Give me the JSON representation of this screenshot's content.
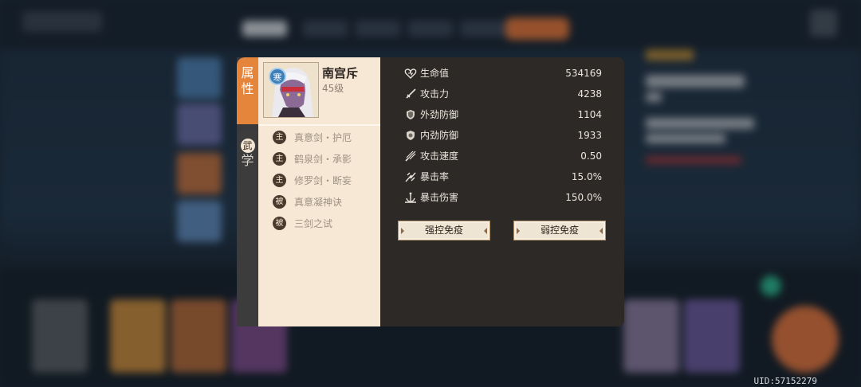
{
  "hero": {
    "name": "南宫斥",
    "level": "45级",
    "element_badge": "寒",
    "portrait": "hero-portrait-icon"
  },
  "side_tabs": [
    {
      "label_line1": "属",
      "label_line2": "性",
      "active": true
    },
    {
      "label_line1": "武",
      "label_line2": "学",
      "active": false
    }
  ],
  "skills": [
    {
      "tag": "主",
      "name": "真意剑・护厄"
    },
    {
      "tag": "主",
      "name": "鹤泉剑・承影"
    },
    {
      "tag": "主",
      "name": "修罗剑・断妄"
    },
    {
      "tag": "被",
      "name": "真意凝神诀"
    },
    {
      "tag": "被",
      "name": "三剑之试"
    }
  ],
  "stats": [
    {
      "icon": "heart-icon",
      "label": "生命值",
      "value": "534169"
    },
    {
      "icon": "sword-icon",
      "label": "攻击力",
      "value": "4238"
    },
    {
      "icon": "shield-icon",
      "label": "外劲防御",
      "value": "1104"
    },
    {
      "icon": "shield-icon",
      "label": "内劲防御",
      "value": "1933"
    },
    {
      "icon": "speed-icon",
      "label": "攻击速度",
      "value": "0.50"
    },
    {
      "icon": "crit-icon",
      "label": "暴击率",
      "value": "15.0%"
    },
    {
      "icon": "crit-damage-icon",
      "label": "暴击伤害",
      "value": "150.0%"
    }
  ],
  "buttons": {
    "strong_immunity": "强控免疫",
    "weak_immunity": "弱控免疫"
  },
  "uid": "UID:57152279",
  "colors": {
    "accent": "#e5843b",
    "panel_light": "#f6e8d4",
    "panel_dark": "#2c2927"
  }
}
